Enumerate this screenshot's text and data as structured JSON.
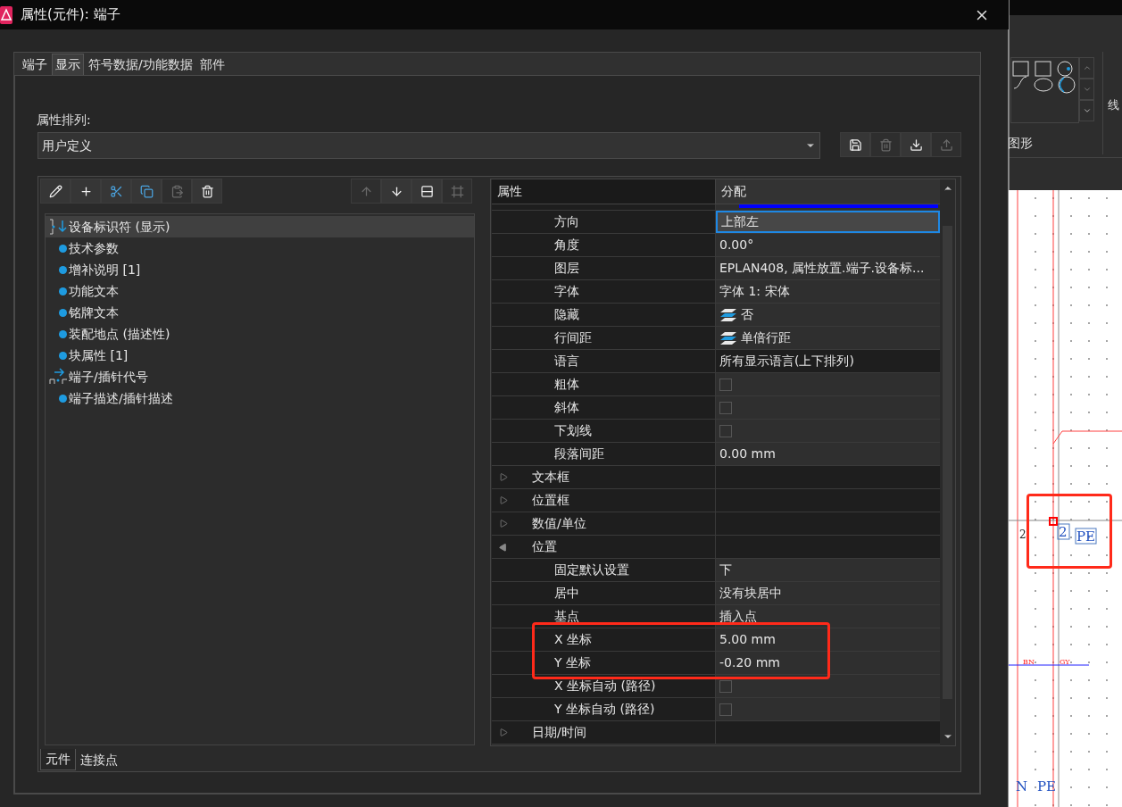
{
  "window": {
    "title": "属性(元件): 端子"
  },
  "tabs": [
    {
      "label": "端子",
      "selected": false
    },
    {
      "label": "显示",
      "selected": true
    },
    {
      "label": "符号数据/功能数据",
      "selected": false
    },
    {
      "label": "部件",
      "selected": false
    }
  ],
  "arrangement": {
    "label": "属性排列:",
    "value": "用户定义"
  },
  "arrangement_buttons": [
    {
      "kind": "save",
      "disabled": false
    },
    {
      "kind": "delete",
      "disabled": true
    },
    {
      "kind": "import",
      "disabled": false
    },
    {
      "kind": "export",
      "disabled": true
    }
  ],
  "toolbar_left": [
    {
      "kind": "edit",
      "disabled": false
    },
    {
      "kind": "add",
      "disabled": false
    },
    {
      "kind": "cut",
      "disabled": false
    },
    {
      "kind": "copy",
      "disabled": false
    },
    {
      "kind": "paste",
      "disabled": true
    },
    {
      "kind": "delete",
      "disabled": false
    }
  ],
  "toolbar_right": [
    {
      "kind": "up",
      "disabled": true
    },
    {
      "kind": "down",
      "disabled": false
    },
    {
      "kind": "distribute",
      "disabled": false
    },
    {
      "kind": "frame",
      "disabled": true
    }
  ],
  "tree": [
    {
      "kind": "identifier",
      "label": "设备标识符 (显示)",
      "selected": true
    },
    {
      "kind": "property",
      "label": "技术参数",
      "selected": false
    },
    {
      "kind": "property",
      "label": "增补说明 [1]",
      "selected": false
    },
    {
      "kind": "property",
      "label": "功能文本",
      "selected": false
    },
    {
      "kind": "property",
      "label": "铭牌文本",
      "selected": false
    },
    {
      "kind": "property",
      "label": "装配地点 (描述性)",
      "selected": false
    },
    {
      "kind": "property",
      "label": "块属性 [1]",
      "selected": false
    },
    {
      "kind": "terminal",
      "label": "端子/插针代号",
      "selected": false
    },
    {
      "kind": "property",
      "label": "端子描述/插针描述",
      "selected": false
    }
  ],
  "bottom_tabs": [
    {
      "label": "元件",
      "selected": true
    },
    {
      "label": "连接点",
      "selected": false
    }
  ],
  "grid": {
    "columns": [
      "属性",
      "分配"
    ],
    "partial_row": {
      "color": "#0000ff"
    },
    "rows": [
      {
        "kind": "text",
        "label": "方向",
        "value": "上部左",
        "selected": true,
        "readonly": false
      },
      {
        "kind": "text",
        "label": "角度",
        "value": "0.00°",
        "selected": false,
        "readonly": false
      },
      {
        "kind": "text",
        "label": "图层",
        "value": "EPLAN408, 属性放置.端子.设备标...",
        "selected": false,
        "readonly": false
      },
      {
        "kind": "text",
        "label": "字体",
        "value": "字体 1: 宋体",
        "selected": false,
        "readonly": false
      },
      {
        "kind": "layered",
        "label": "隐藏",
        "value": "否",
        "selected": false,
        "readonly": false
      },
      {
        "kind": "layered",
        "label": "行间距",
        "value": "单倍行距",
        "selected": false,
        "readonly": false
      },
      {
        "kind": "text",
        "label": "语言",
        "value": "所有显示语言(上下排列)",
        "selected": false,
        "readonly": true
      },
      {
        "kind": "check",
        "label": "粗体",
        "checked": false,
        "selected": false,
        "readonly": false
      },
      {
        "kind": "check",
        "label": "斜体",
        "checked": false,
        "selected": false,
        "readonly": false
      },
      {
        "kind": "check",
        "label": "下划线",
        "checked": false,
        "selected": false,
        "readonly": false
      },
      {
        "kind": "text",
        "label": "段落间距",
        "value": "0.00 mm",
        "selected": false,
        "readonly": false
      },
      {
        "kind": "group",
        "label": "文本框",
        "expanded": false
      },
      {
        "kind": "group",
        "label": "位置框",
        "expanded": false
      },
      {
        "kind": "group",
        "label": "数值/单位",
        "expanded": false
      },
      {
        "kind": "group",
        "label": "位置",
        "expanded": true
      },
      {
        "kind": "text",
        "label": "固定默认设置",
        "value": "下",
        "selected": false,
        "readonly": false
      },
      {
        "kind": "text",
        "label": "居中",
        "value": "没有块居中",
        "selected": false,
        "readonly": false
      },
      {
        "kind": "text",
        "label": "基点",
        "value": "插入点",
        "selected": false,
        "readonly": false
      },
      {
        "kind": "text",
        "label": "X 坐标",
        "value": "5.00 mm",
        "selected": false,
        "readonly": false
      },
      {
        "kind": "text",
        "label": "Y 坐标",
        "value": "-0.20 mm",
        "selected": false,
        "readonly": false
      },
      {
        "kind": "check",
        "label": "X 坐标自动 (路径)",
        "checked": false,
        "selected": false,
        "readonly": false
      },
      {
        "kind": "check",
        "label": "Y 坐标自动 (路径)",
        "checked": false,
        "selected": false,
        "readonly": false
      },
      {
        "kind": "group",
        "label": "日期/时间",
        "expanded": false
      }
    ]
  },
  "ribbon": {
    "group_label": "图形",
    "next_label": "线"
  },
  "schematic": {
    "labels": [
      {
        "text": "2",
        "boxed": false
      },
      {
        "text": "2",
        "boxed": true
      },
      {
        "text": "PE",
        "boxed": true
      },
      {
        "text": "BN",
        "boxed": false
      },
      {
        "text": "GY",
        "boxed": false
      },
      {
        "text": "N",
        "boxed": false
      },
      {
        "text": "PE",
        "boxed": false
      }
    ]
  }
}
